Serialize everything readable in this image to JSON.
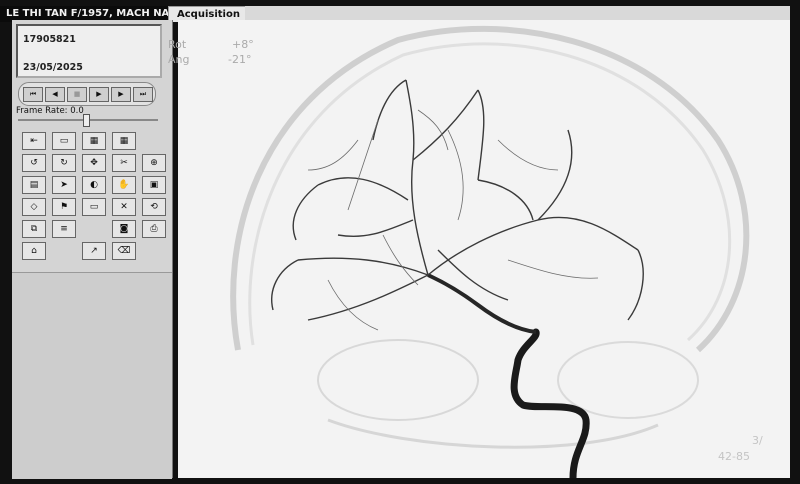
{
  "header": {
    "patient_title": "LE THI TAN F/1957, MACH NA",
    "tab_label": "Acquisition"
  },
  "patient_info": {
    "id": "17905821",
    "date": "23/05/2025"
  },
  "cine_controls": {
    "buttons": [
      "first-frame-icon",
      "prev-frame-icon",
      "stop-icon",
      "play-icon",
      "next-frame-icon",
      "last-frame-icon"
    ],
    "frame_rate_label": "Frame Rate: 0.0"
  },
  "tools": {
    "icons": [
      "series-step-icon",
      "folder-icon",
      "frame-grid-icon",
      "layout-grid-icon",
      "rotate-left-icon",
      "rotate-right-icon",
      "pan-icon",
      "cut-icon",
      "zoom-tool-icon",
      "film-icon",
      "pointer-icon",
      "window-level-icon",
      "hand-icon",
      "marker-icon",
      "diamond-icon",
      "flag-icon",
      "note-icon",
      "close-box-icon",
      "reset-icon",
      "copy-icon",
      "list-icon",
      "camera-icon",
      "print-icon",
      "export-icon",
      "measure-icon",
      "eraser-icon"
    ]
  },
  "image_overlay": {
    "rot_label": "Rot",
    "rot_value": "+8°",
    "ang_label": "Ang",
    "ang_value": "-21°",
    "bottom_right_1": "3/",
    "bottom_right_2": "42-85"
  },
  "colors": {
    "panel_bg": "#d4d4d4",
    "viewport_bg": "#f3f3f3",
    "vessel": "#1a1a1a"
  }
}
